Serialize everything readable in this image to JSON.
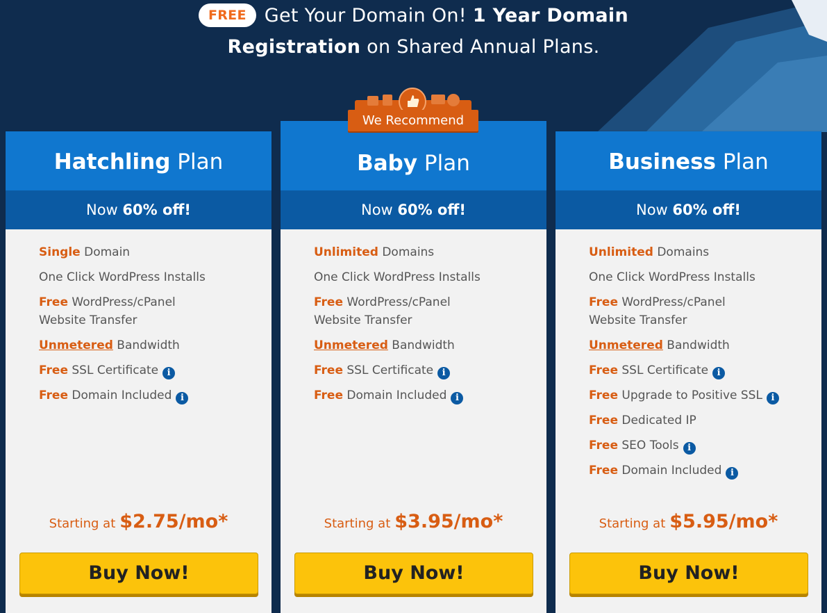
{
  "header": {
    "free_badge": "FREE",
    "line1_text": "Get Your Domain On!",
    "line1_bold": "1 Year Domain",
    "line2_bold": "Registration",
    "line2_text": "on Shared Annual Plans."
  },
  "ribbon": {
    "label": "We Recommend"
  },
  "colors": {
    "accent_orange": "#d85d13",
    "header_blue": "#1077cf",
    "discount_blue": "#0b5aa3",
    "button_yellow": "#fcc30b",
    "background_navy": "#0f2c4e"
  },
  "plans": [
    {
      "name_bold": "Hatchling",
      "name_text": "Plan",
      "discount_prefix": "Now",
      "discount_bold": "60% off!",
      "features": [
        {
          "hl": "Single",
          "text": "Domain"
        },
        {
          "hl": "",
          "text": "One Click WordPress Installs"
        },
        {
          "hl": "Free",
          "text": "WordPress/cPanel",
          "text2": "Website Transfer"
        },
        {
          "hl": "Unmetered",
          "text": "Bandwidth"
        },
        {
          "hl": "Free",
          "text": "SSL Certificate"
        },
        {
          "hl": "Free",
          "text": "Domain Included"
        }
      ],
      "price_label": "Starting at",
      "price": "$2.75/mo*",
      "button": "Buy Now!"
    },
    {
      "name_bold": "Baby",
      "name_text": "Plan",
      "discount_prefix": "Now",
      "discount_bold": "60% off!",
      "features": [
        {
          "hl": "Unlimited",
          "text": "Domains"
        },
        {
          "hl": "",
          "text": "One Click WordPress Installs"
        },
        {
          "hl": "Free",
          "text": "WordPress/cPanel",
          "text2": "Website Transfer"
        },
        {
          "hl": "Unmetered",
          "text": "Bandwidth"
        },
        {
          "hl": "Free",
          "text": "SSL Certificate"
        },
        {
          "hl": "Free",
          "text": "Domain Included"
        }
      ],
      "price_label": "Starting at",
      "price": "$3.95/mo*",
      "button": "Buy Now!"
    },
    {
      "name_bold": "Business",
      "name_text": "Plan",
      "discount_prefix": "Now",
      "discount_bold": "60% off!",
      "features": [
        {
          "hl": "Unlimited",
          "text": "Domains"
        },
        {
          "hl": "",
          "text": "One Click WordPress Installs"
        },
        {
          "hl": "Free",
          "text": "WordPress/cPanel",
          "text2": "Website Transfer"
        },
        {
          "hl": "Unmetered",
          "text": "Bandwidth"
        },
        {
          "hl": "Free",
          "text": "SSL Certificate"
        },
        {
          "hl": "Free",
          "text": "Upgrade to Positive SSL"
        },
        {
          "hl": "Free",
          "text": "Dedicated IP"
        },
        {
          "hl": "Free",
          "text": "SEO Tools"
        },
        {
          "hl": "Free",
          "text": "Domain Included"
        }
      ],
      "price_label": "Starting at",
      "price": "$5.95/mo*",
      "button": "Buy Now!"
    }
  ]
}
